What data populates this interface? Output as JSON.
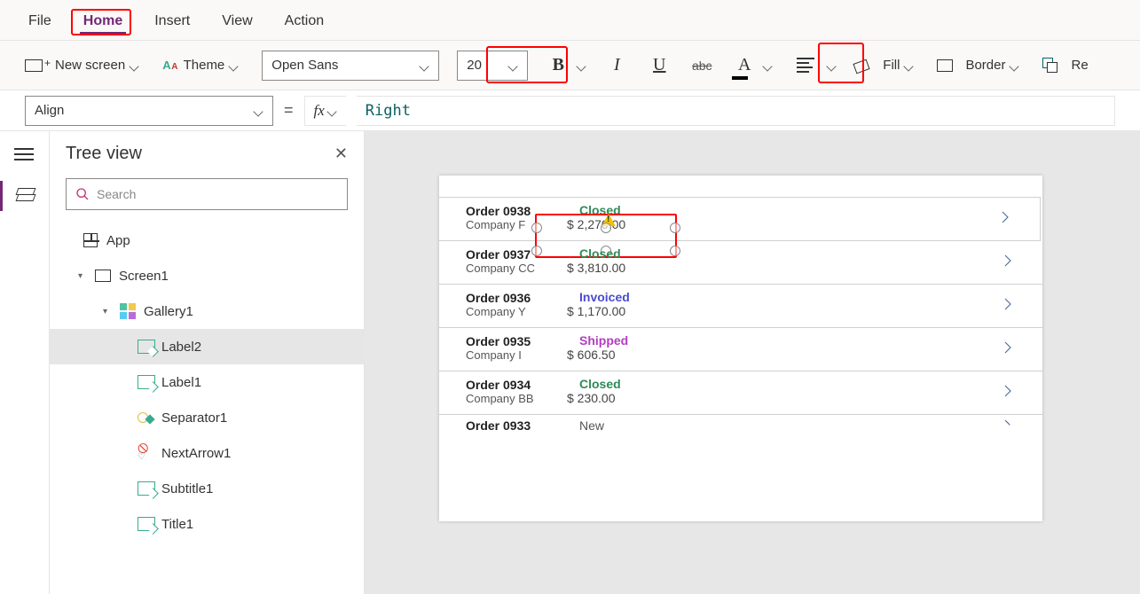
{
  "menu": {
    "file": "File",
    "home": "Home",
    "insert": "Insert",
    "view": "View",
    "action": "Action"
  },
  "ribbon": {
    "newScreen": "New screen",
    "theme": "Theme",
    "font": "Open Sans",
    "size": "20",
    "fill": "Fill",
    "border": "Border",
    "reorder": "Re"
  },
  "formula": {
    "property": "Align",
    "fx": "fx",
    "value": "Right"
  },
  "tree": {
    "title": "Tree view",
    "searchPlaceholder": "Search",
    "app": "App",
    "screen1": "Screen1",
    "gallery1": "Gallery1",
    "label2": "Label2",
    "label1": "Label1",
    "separator1": "Separator1",
    "nextarrow1": "NextArrow1",
    "subtitle1": "Subtitle1",
    "title1": "Title1"
  },
  "gallery": {
    "items": [
      {
        "order": "Order 0938",
        "company": "Company F",
        "status": "Closed",
        "statusClass": "status-closed",
        "price": "$ 2,270.00"
      },
      {
        "order": "Order 0937",
        "company": "Company CC",
        "status": "Closed",
        "statusClass": "status-closed",
        "price": "$ 3,810.00"
      },
      {
        "order": "Order 0936",
        "company": "Company Y",
        "status": "Invoiced",
        "statusClass": "status-invoiced",
        "price": "$ 1,170.00"
      },
      {
        "order": "Order 0935",
        "company": "Company I",
        "status": "Shipped",
        "statusClass": "status-shipped",
        "price": "$ 606.50"
      },
      {
        "order": "Order 0934",
        "company": "Company BB",
        "status": "Closed",
        "statusClass": "status-closed",
        "price": "$ 230.00"
      },
      {
        "order": "Order 0933",
        "company": "",
        "status": "New",
        "statusClass": "status-new",
        "price": ""
      }
    ]
  }
}
